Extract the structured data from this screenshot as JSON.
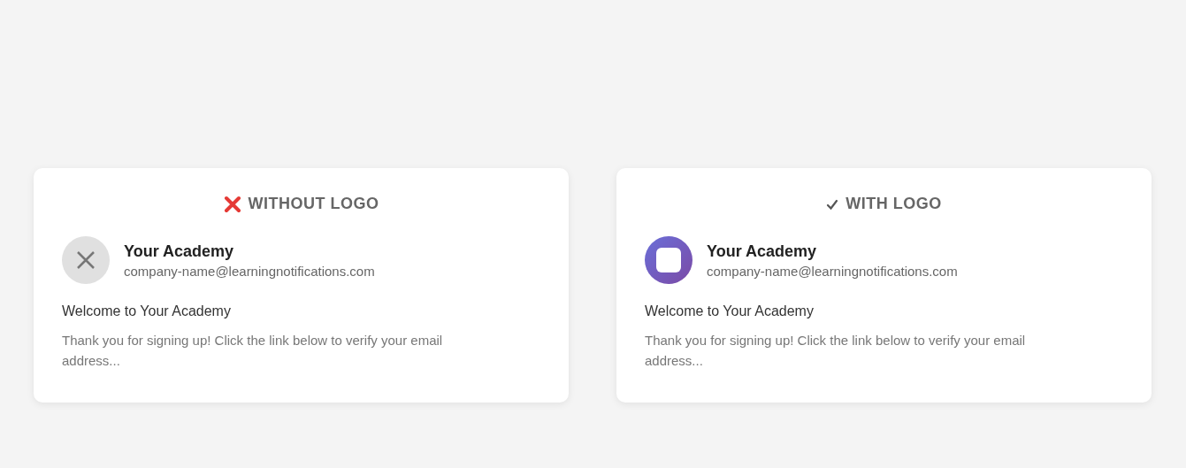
{
  "cards": [
    {
      "kind": "without-logo",
      "heading": "WITHOUT LOGO",
      "sender": "Your Academy",
      "email": "company-name@learningnotifications.com",
      "subject": "Welcome to Your Academy",
      "preview": "Thank you for signing up! Click the link below to verify your email address..."
    },
    {
      "kind": "with-logo",
      "heading": "WITH LOGO",
      "sender": "Your Academy",
      "email": "company-name@learningnotifications.com",
      "subject": "Welcome to Your Academy",
      "preview": "Thank you for signing up! Click the link below to verify your email address..."
    }
  ]
}
